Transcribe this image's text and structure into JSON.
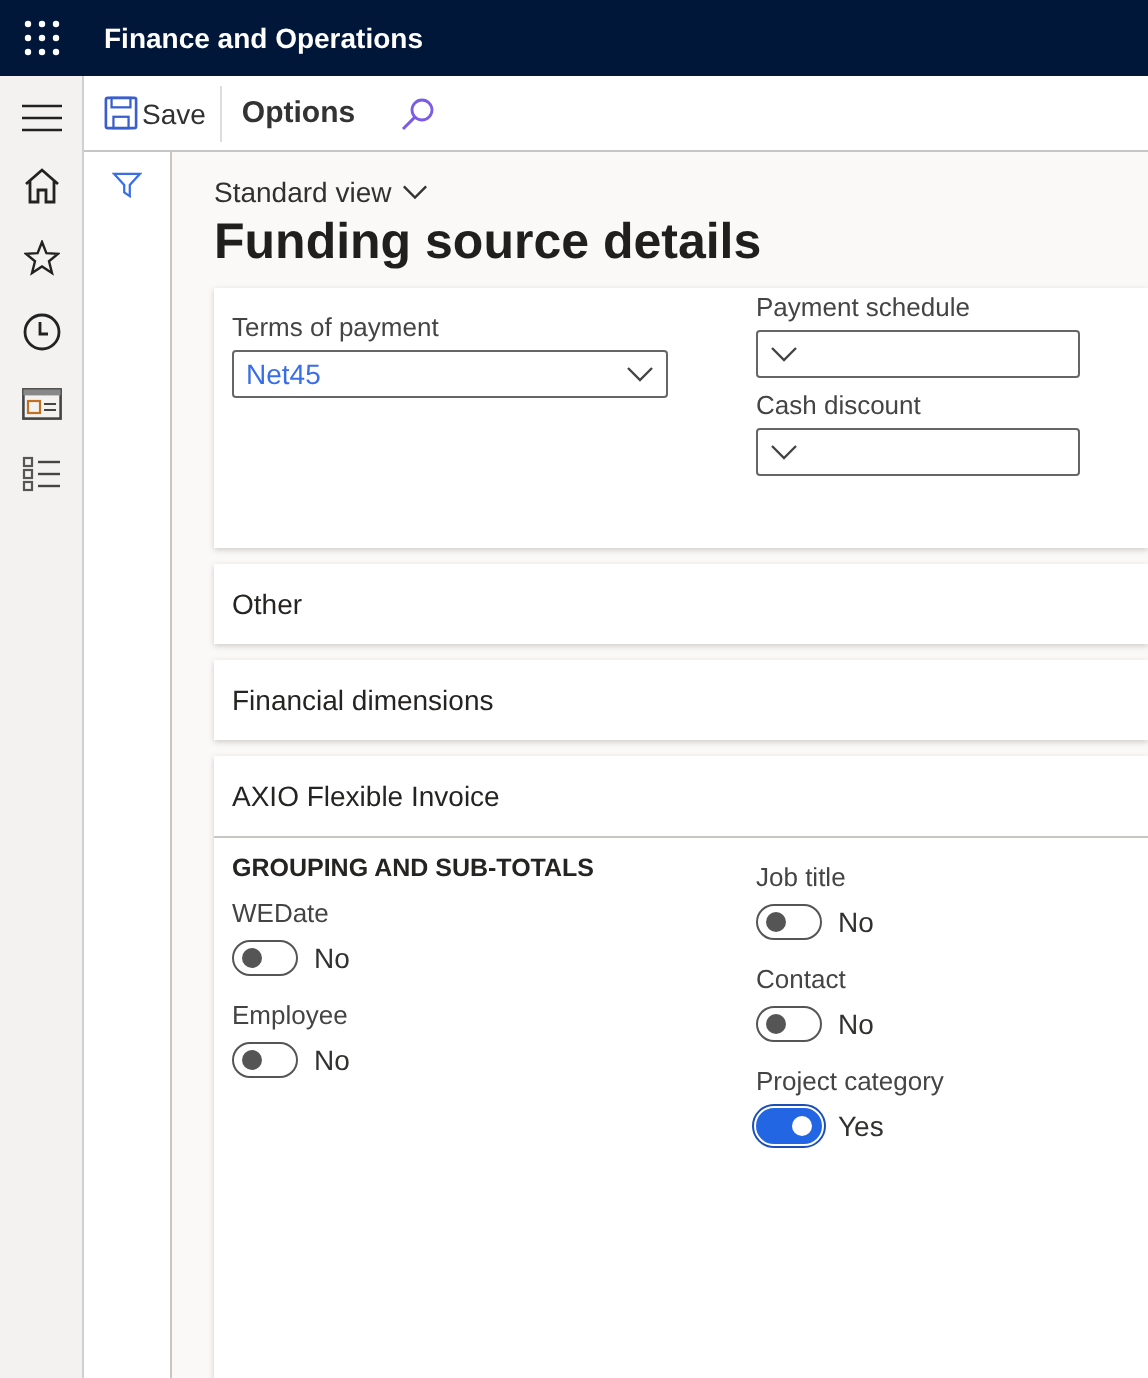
{
  "app_bar": {
    "title": "Finance and Operations"
  },
  "toolbar": {
    "save": "Save",
    "options": "Options"
  },
  "page": {
    "view": "Standard view",
    "title": "Funding source details"
  },
  "payment": {
    "left": [
      {
        "label": "Terms of payment",
        "value": "Net45"
      }
    ],
    "right": [
      {
        "label": "Payment schedule"
      },
      {
        "label": "Cash discount"
      }
    ]
  },
  "sections": [
    {
      "title": "Other",
      "expanded": false
    },
    {
      "title": "Financial dimensions",
      "expanded": false
    },
    {
      "title": "AXIO Flexible Invoice",
      "expanded": true,
      "group_title": "GROUPING AND SUB-TOTALS",
      "columns": [
        [
          {
            "label": "WEDate",
            "on": false,
            "value": "No"
          },
          {
            "label": "Employee",
            "on": false,
            "value": "No"
          }
        ],
        [
          {
            "label": "Job title",
            "on": false,
            "value": "No"
          },
          {
            "label": "Contact",
            "on": false,
            "value": "No"
          },
          {
            "label": "Project category",
            "on": true,
            "value": "Yes"
          }
        ]
      ]
    }
  ]
}
